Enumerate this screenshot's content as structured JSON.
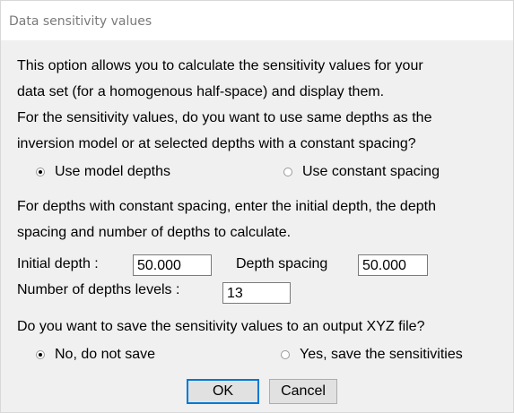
{
  "window": {
    "title": "Data sensitivity values"
  },
  "intro": {
    "line1": "This option allows you to calculate the sensitivity values for your",
    "line2": "data set (for a homogenous half-space) and display them.",
    "line3": "For the sensitivity values, do you want to use same depths as the",
    "line4": "inversion model or at selected depths with a constant spacing?"
  },
  "depth_mode": {
    "option1": "Use model depths",
    "option2": "Use constant spacing",
    "selected": "Use model depths"
  },
  "spacing_text": {
    "line1": "For depths with constant spacing, enter the initial depth, the depth",
    "line2": "spacing and number of depths to calculate."
  },
  "fields": {
    "initial_depth_label": "Initial depth :",
    "initial_depth_value": "50.000",
    "depth_spacing_label": "Depth spacing",
    "depth_spacing_value": "50.000",
    "num_levels_label": "Number of depths levels :",
    "num_levels_value": "13"
  },
  "save": {
    "question": "Do you want to save the sensitivity values to an output XYZ file?",
    "option1": "No, do not save",
    "option2": "Yes, save the sensitivities",
    "selected": "No, do not save"
  },
  "buttons": {
    "ok": "OK",
    "cancel": "Cancel"
  }
}
